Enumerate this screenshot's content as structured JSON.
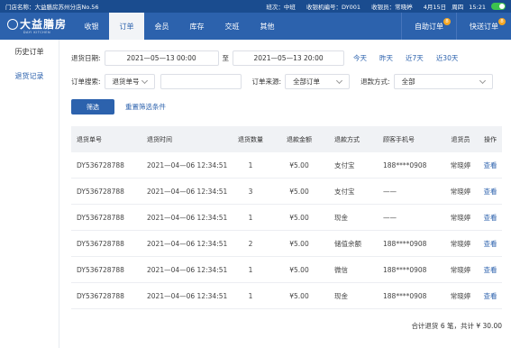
{
  "topbar": {
    "store": "门店名称：大益膳房苏州分店No.56",
    "shift": "班次：中班",
    "terminal": "收银机编号：DY001",
    "cashier": "收银员：常晓婷",
    "date": "4月15日",
    "weekday": "周四",
    "time": "15:21"
  },
  "navbar": {
    "logo_cn": "大益膳房",
    "logo_en": "DAYI KITCHEN",
    "tabs": [
      "收银",
      "订单",
      "会员",
      "库存",
      "交班",
      "其他"
    ],
    "active_tab": 1,
    "self_order": "自助订单",
    "self_order_count": "8",
    "delivery_order": "快送订单",
    "delivery_order_count": "8"
  },
  "sidebar": {
    "items": [
      "历史订单",
      "退货记录"
    ],
    "active": 1
  },
  "filters": {
    "date_label": "退货日期:",
    "start_date": "2021—05—13 00:00",
    "to": "至",
    "end_date": "2021—05—13 20:00",
    "quick": [
      "今天",
      "昨天",
      "近7天",
      "近30天"
    ],
    "search_label": "订单搜索:",
    "search_type": "退货单号",
    "search_value": "",
    "source_label": "订单来源:",
    "source_value": "全部订单",
    "method_label": "退款方式:",
    "method_value": "全部",
    "filter_button": "筛选",
    "reset_link": "重置筛选条件"
  },
  "table": {
    "headers": [
      "退货单号",
      "退货时间",
      "退货数量",
      "退款金额",
      "退款方式",
      "顾客手机号",
      "退货员",
      "操作"
    ],
    "rows": [
      [
        "DY536728788",
        "2021—04—06 12:34:51",
        "1",
        "¥5.00",
        "支付宝",
        "188****0908",
        "常晓婷",
        "查看"
      ],
      [
        "DY536728788",
        "2021—04—06 12:34:51",
        "3",
        "¥5.00",
        "支付宝",
        "——",
        "常晓婷",
        "查看"
      ],
      [
        "DY536728788",
        "2021—04—06 12:34:51",
        "1",
        "¥5.00",
        "现金",
        "——",
        "常晓婷",
        "查看"
      ],
      [
        "DY536728788",
        "2021—04—06 12:34:51",
        "2",
        "¥5.00",
        "储值余额",
        "188****0908",
        "常晓婷",
        "查看"
      ],
      [
        "DY536728788",
        "2021—04—06 12:34:51",
        "1",
        "¥5.00",
        "微信",
        "188****0908",
        "常晓婷",
        "查看"
      ],
      [
        "DY536728788",
        "2021—04—06 12:34:51",
        "1",
        "¥5.00",
        "现金",
        "188****0908",
        "常晓婷",
        "查看"
      ]
    ]
  },
  "summary": "合计退货 6 笔，共计 ¥ 30.00"
}
